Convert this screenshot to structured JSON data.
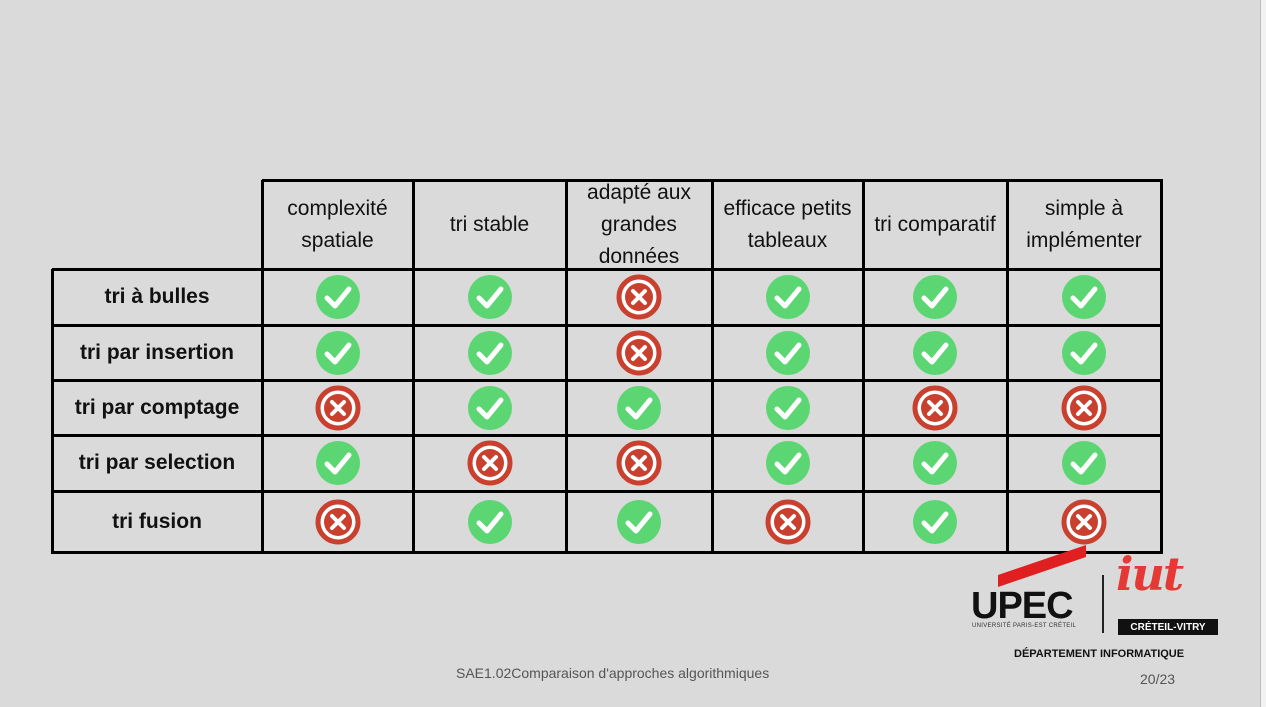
{
  "table": {
    "columns": [
      "complexité spatiale",
      "tri stable",
      "adapté aux grandes données",
      "efficace petits tableaux",
      "tri comparatif",
      "simple à implémenter"
    ],
    "rows": [
      {
        "label": "tri à bulles",
        "values": [
          "yes",
          "yes",
          "no",
          "yes",
          "yes",
          "yes"
        ]
      },
      {
        "label": "tri par insertion",
        "values": [
          "yes",
          "yes",
          "no",
          "yes",
          "yes",
          "yes"
        ]
      },
      {
        "label": "tri par comptage",
        "values": [
          "no",
          "yes",
          "yes",
          "yes",
          "no",
          "no"
        ]
      },
      {
        "label": "tri par selection",
        "values": [
          "yes",
          "no",
          "no",
          "yes",
          "yes",
          "yes"
        ]
      },
      {
        "label": "tri fusion",
        "values": [
          "no",
          "yes",
          "yes",
          "no",
          "yes",
          "no"
        ]
      }
    ]
  },
  "icons": {
    "yes": "check-circle-icon",
    "no": "cross-circle-icon"
  },
  "colors": {
    "yes": "#5cd672",
    "no": "#c9402f",
    "background": "#dadada"
  },
  "footer": {
    "title": "SAE1.02Comparaison d'approches algorithmiques",
    "page": "20/23"
  },
  "logo": {
    "upec": "UPEC",
    "upec_sub": "UNIVERSITÉ PARIS-EST CRÉTEIL",
    "iut": "iut",
    "campus": "CRÉTEIL-VITRY",
    "department": "DÉPARTEMENT INFORMATIQUE"
  }
}
